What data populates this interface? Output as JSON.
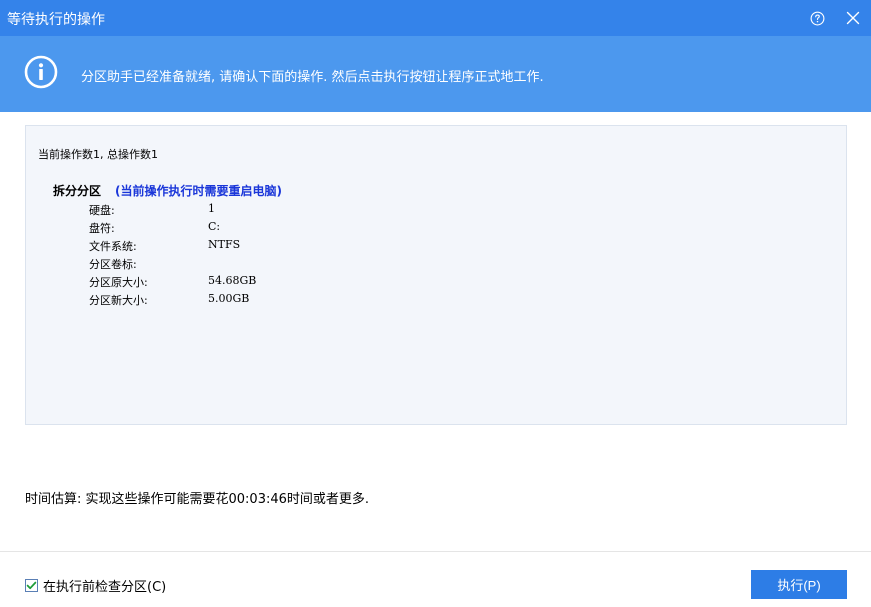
{
  "window": {
    "title": "等待执行的操作"
  },
  "banner": {
    "message": "分区助手已经准备就绪, 请确认下面的操作. 然后点击执行按钮让程序正式地工作."
  },
  "operations": {
    "summary": "当前操作数1,  总操作数1",
    "items": [
      {
        "name": "拆分分区",
        "note": "(当前操作执行时需要重启电脑)",
        "details": [
          {
            "label": "硬盘:",
            "value": "1"
          },
          {
            "label": "盘符:",
            "value": "C:"
          },
          {
            "label": "文件系统:",
            "value": "NTFS"
          },
          {
            "label": "分区卷标:",
            "value": ""
          },
          {
            "label": "分区原大小:",
            "value": "54.68GB"
          },
          {
            "label": "分区新大小:",
            "value": "5.00GB"
          }
        ]
      }
    ]
  },
  "estimate": {
    "text": "时间估算: 实现这些操作可能需要花00:03:46时间或者更多."
  },
  "footer": {
    "check_label": "在执行前检查分区(C)",
    "check_checked": true,
    "execute_label": "执行(P)"
  },
  "colors": {
    "titlebar": "#3483ea",
    "banner": "#4c98ee",
    "note": "#1a36d9",
    "button": "#2d7de6"
  },
  "icons": {
    "help": "help-circle-icon",
    "close": "close-icon",
    "info": "info-icon",
    "check": "checkmark-icon"
  }
}
